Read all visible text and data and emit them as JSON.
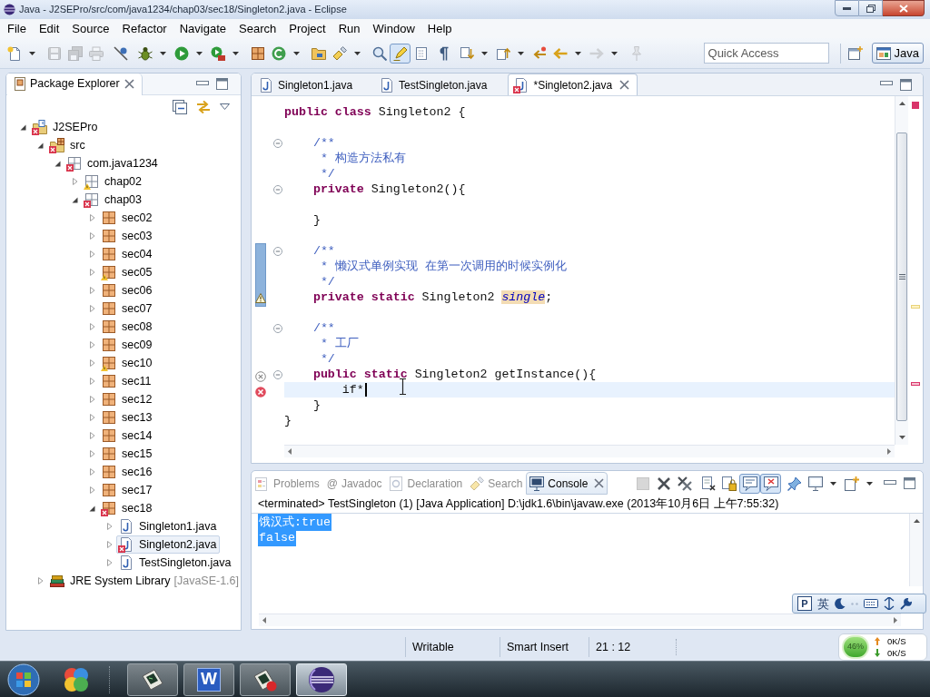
{
  "window": {
    "title": "Java - J2SEPro/src/com/java1234/chap03/sec18/Singleton2.java - Eclipse"
  },
  "menu": [
    "File",
    "Edit",
    "Source",
    "Refactor",
    "Navigate",
    "Search",
    "Project",
    "Run",
    "Window",
    "Help"
  ],
  "toolbar": {
    "groups": [
      {
        "buttons": [
          {
            "kind": "new",
            "menu": true,
            "pressed": false,
            "disabled": false
          }
        ]
      },
      {
        "buttons": [
          {
            "kind": "save",
            "menu": false,
            "pressed": false,
            "disabled": true
          },
          {
            "kind": "save-all",
            "menu": false,
            "pressed": false,
            "disabled": true
          },
          {
            "kind": "print",
            "menu": false,
            "pressed": false,
            "disabled": true
          }
        ]
      },
      {
        "buttons": [
          {
            "kind": "skip-breakpoints",
            "menu": false,
            "pressed": false,
            "disabled": false
          }
        ]
      },
      {
        "buttons": [
          {
            "kind": "debug",
            "menu": true,
            "pressed": false,
            "disabled": false
          },
          {
            "kind": "run",
            "menu": true,
            "pressed": false,
            "disabled": false
          },
          {
            "kind": "external-tools",
            "menu": true,
            "pressed": false,
            "disabled": false
          }
        ]
      },
      {
        "buttons": [
          {
            "kind": "new-package",
            "menu": false,
            "pressed": false,
            "disabled": false
          },
          {
            "kind": "new-class",
            "menu": true,
            "pressed": false,
            "disabled": false
          }
        ]
      },
      {
        "buttons": [
          {
            "kind": "open-type",
            "menu": false,
            "pressed": false,
            "disabled": false
          },
          {
            "kind": "search",
            "menu": true,
            "pressed": false,
            "disabled": false
          }
        ]
      },
      {
        "buttons": [
          {
            "kind": "open-task",
            "menu": false,
            "pressed": false,
            "disabled": false
          },
          {
            "kind": "mark-occurrences",
            "menu": false,
            "pressed": true,
            "disabled": false
          },
          {
            "kind": "block-selection",
            "menu": false,
            "pressed": false,
            "disabled": false
          },
          {
            "kind": "whitespace",
            "menu": false,
            "pressed": false,
            "disabled": false
          }
        ]
      },
      {
        "buttons": [
          {
            "kind": "next-annotation",
            "menu": true,
            "pressed": false,
            "disabled": false
          },
          {
            "kind": "prev-annotation",
            "menu": true,
            "pressed": false,
            "disabled": false
          },
          {
            "kind": "last-edit",
            "menu": false,
            "pressed": false,
            "disabled": false
          },
          {
            "kind": "back",
            "menu": true,
            "pressed": false,
            "disabled": false
          },
          {
            "kind": "forward",
            "menu": true,
            "pressed": false,
            "disabled": true
          }
        ]
      },
      {
        "buttons": [
          {
            "kind": "pin",
            "menu": false,
            "pressed": false,
            "disabled": true
          }
        ]
      }
    ],
    "quick_access": {
      "placeholder": "Quick Access"
    },
    "perspectives": [
      {
        "label": "Java",
        "selected": true
      }
    ]
  },
  "package_explorer": {
    "title": "Package Explorer",
    "tree": [
      {
        "label": "J2SEPro",
        "kind": "project",
        "error": true,
        "warning": false,
        "expanded": true,
        "selected": false,
        "children": [
          {
            "label": "src",
            "kind": "source-folder",
            "error": true,
            "warning": false,
            "expanded": true,
            "selected": false,
            "children": [
              {
                "label": "com.java1234",
                "kind": "empty-package",
                "error": true,
                "warning": false,
                "expanded": true,
                "selected": false,
                "children": [
                  {
                    "label": "chap02",
                    "kind": "empty-package",
                    "error": false,
                    "warning": true,
                    "expanded": false,
                    "selected": false
                  },
                  {
                    "label": "chap03",
                    "kind": "empty-package",
                    "error": true,
                    "warning": false,
                    "expanded": true,
                    "selected": false,
                    "children": [
                      {
                        "label": "sec02",
                        "kind": "package",
                        "error": false,
                        "warning": false,
                        "expanded": false,
                        "selected": false
                      },
                      {
                        "label": "sec03",
                        "kind": "package",
                        "error": false,
                        "warning": false,
                        "expanded": false,
                        "selected": false
                      },
                      {
                        "label": "sec04",
                        "kind": "package",
                        "error": false,
                        "warning": false,
                        "expanded": false,
                        "selected": false
                      },
                      {
                        "label": "sec05",
                        "kind": "package",
                        "error": false,
                        "warning": true,
                        "expanded": false,
                        "selected": false
                      },
                      {
                        "label": "sec06",
                        "kind": "package",
                        "error": false,
                        "warning": false,
                        "expanded": false,
                        "selected": false
                      },
                      {
                        "label": "sec07",
                        "kind": "package",
                        "error": false,
                        "warning": false,
                        "expanded": false,
                        "selected": false
                      },
                      {
                        "label": "sec08",
                        "kind": "package",
                        "error": false,
                        "warning": false,
                        "expanded": false,
                        "selected": false
                      },
                      {
                        "label": "sec09",
                        "kind": "package",
                        "error": false,
                        "warning": false,
                        "expanded": false,
                        "selected": false
                      },
                      {
                        "label": "sec10",
                        "kind": "package",
                        "error": false,
                        "warning": true,
                        "expanded": false,
                        "selected": false
                      },
                      {
                        "label": "sec11",
                        "kind": "package",
                        "error": false,
                        "warning": false,
                        "expanded": false,
                        "selected": false
                      },
                      {
                        "label": "sec12",
                        "kind": "package",
                        "error": false,
                        "warning": false,
                        "expanded": false,
                        "selected": false
                      },
                      {
                        "label": "sec13",
                        "kind": "package",
                        "error": false,
                        "warning": false,
                        "expanded": false,
                        "selected": false
                      },
                      {
                        "label": "sec14",
                        "kind": "package",
                        "error": false,
                        "warning": false,
                        "expanded": false,
                        "selected": false
                      },
                      {
                        "label": "sec15",
                        "kind": "package",
                        "error": false,
                        "warning": false,
                        "expanded": false,
                        "selected": false
                      },
                      {
                        "label": "sec16",
                        "kind": "package",
                        "error": false,
                        "warning": false,
                        "expanded": false,
                        "selected": false
                      },
                      {
                        "label": "sec17",
                        "kind": "package",
                        "error": false,
                        "warning": false,
                        "expanded": false,
                        "selected": false
                      },
                      {
                        "label": "sec18",
                        "kind": "package",
                        "error": true,
                        "warning": false,
                        "expanded": true,
                        "selected": false,
                        "children": [
                          {
                            "label": "Singleton1.java",
                            "kind": "java-file",
                            "error": false,
                            "warning": false,
                            "expanded": false,
                            "selected": false
                          },
                          {
                            "label": "Singleton2.java",
                            "kind": "java-file",
                            "error": true,
                            "warning": false,
                            "expanded": false,
                            "selected": true
                          },
                          {
                            "label": "TestSingleton.java",
                            "kind": "java-file",
                            "error": false,
                            "warning": false,
                            "expanded": false,
                            "selected": false
                          }
                        ]
                      }
                    ]
                  }
                ]
              }
            ]
          },
          {
            "label": "JRE System Library",
            "decoration": "[JavaSE-1.6]",
            "kind": "library",
            "error": false,
            "warning": false,
            "expanded": false,
            "selected": false
          }
        ]
      }
    ]
  },
  "editor": {
    "tabs": [
      {
        "label": "Singleton1.java",
        "error": false,
        "selected": false
      },
      {
        "label": "TestSingleton.java",
        "error": false,
        "selected": false
      },
      {
        "label": "*Singleton2.java",
        "error": true,
        "selected": true
      }
    ],
    "lines": [
      {
        "tokens": [
          {
            "kind": "keyword",
            "text": "public "
          },
          {
            "kind": "keyword",
            "text": "class "
          },
          {
            "kind": "text",
            "text": "Singleton2 {"
          }
        ],
        "fold": false,
        "changed": false,
        "current": false,
        "warning": false,
        "error": false,
        "stale_error": false
      },
      {
        "fold": false,
        "changed": false,
        "current": false,
        "warning": false,
        "error": false,
        "stale_error": false
      },
      {
        "tokens": [
          {
            "kind": "comment",
            "text": "    /**"
          }
        ],
        "fold": true,
        "changed": false,
        "current": false,
        "warning": false,
        "error": false,
        "stale_error": false
      },
      {
        "tokens": [
          {
            "kind": "comment",
            "text": "     * 构造方法私有"
          }
        ],
        "fold": false,
        "changed": false,
        "current": false,
        "warning": false,
        "error": false,
        "stale_error": false
      },
      {
        "tokens": [
          {
            "kind": "comment",
            "text": "     */"
          }
        ],
        "fold": false,
        "changed": false,
        "current": false,
        "warning": false,
        "error": false,
        "stale_error": false
      },
      {
        "tokens": [
          {
            "kind": "keyword",
            "text": "    private "
          },
          {
            "kind": "text",
            "text": "Singleton2(){"
          }
        ],
        "fold": true,
        "changed": false,
        "current": false,
        "warning": false,
        "error": false,
        "stale_error": false
      },
      {
        "fold": false,
        "changed": false,
        "current": false,
        "warning": false,
        "error": false,
        "stale_error": false
      },
      {
        "tokens": [
          {
            "kind": "text",
            "text": "    }"
          }
        ],
        "fold": false,
        "changed": false,
        "current": false,
        "warning": false,
        "error": false,
        "stale_error": false
      },
      {
        "fold": false,
        "changed": false,
        "current": false,
        "warning": false,
        "error": false,
        "stale_error": false
      },
      {
        "tokens": [
          {
            "kind": "comment",
            "text": "    /**"
          }
        ],
        "fold": true,
        "changed": true,
        "current": false,
        "warning": false,
        "error": false,
        "stale_error": false
      },
      {
        "tokens": [
          {
            "kind": "comment",
            "text": "     * 懒汉式单例实现 在第一次调用的时候实例化"
          }
        ],
        "fold": false,
        "changed": true,
        "current": false,
        "warning": false,
        "error": false,
        "stale_error": false
      },
      {
        "tokens": [
          {
            "kind": "comment",
            "text": "     */"
          }
        ],
        "fold": false,
        "changed": true,
        "current": false,
        "warning": false,
        "error": false,
        "stale_error": false
      },
      {
        "tokens": [
          {
            "kind": "keyword",
            "text": "    private "
          },
          {
            "kind": "keyword",
            "text": "static "
          },
          {
            "kind": "text",
            "text": "Singleton2 "
          },
          {
            "kind": "field",
            "text": "single"
          },
          {
            "kind": "text",
            "text": ";"
          }
        ],
        "fold": false,
        "changed": true,
        "current": false,
        "warning": true,
        "error": false,
        "stale_error": false
      },
      {
        "fold": false,
        "changed": false,
        "current": false,
        "warning": false,
        "error": false,
        "stale_error": false
      },
      {
        "tokens": [
          {
            "kind": "comment",
            "text": "    /**"
          }
        ],
        "fold": true,
        "changed": false,
        "current": false,
        "warning": false,
        "error": false,
        "stale_error": false
      },
      {
        "tokens": [
          {
            "kind": "comment",
            "text": "     * 工厂"
          }
        ],
        "fold": false,
        "changed": false,
        "current": false,
        "warning": false,
        "error": false,
        "stale_error": false
      },
      {
        "tokens": [
          {
            "kind": "comment",
            "text": "     */"
          }
        ],
        "fold": false,
        "changed": false,
        "current": false,
        "warning": false,
        "error": false,
        "stale_error": false
      },
      {
        "tokens": [
          {
            "kind": "keyword",
            "text": "    public "
          },
          {
            "kind": "keyword",
            "text": "static "
          },
          {
            "kind": "text",
            "text": "Singleton2 getInstance(){"
          }
        ],
        "fold": true,
        "changed": false,
        "current": false,
        "warning": false,
        "error": false,
        "stale_error": true
      },
      {
        "tokens": [
          {
            "kind": "text",
            "text": "        if*"
          }
        ],
        "fold": false,
        "changed": false,
        "current": true,
        "warning": false,
        "error": true,
        "stale_error": false
      },
      {
        "tokens": [
          {
            "kind": "text",
            "text": "    }"
          }
        ],
        "fold": false,
        "changed": false,
        "current": false,
        "warning": false,
        "error": false,
        "stale_error": false
      },
      {
        "tokens": [
          {
            "kind": "text",
            "text": "}"
          }
        ],
        "fold": false,
        "changed": false,
        "current": false,
        "warning": false,
        "error": false,
        "stale_error": false
      }
    ]
  },
  "console_view": {
    "tabs": [
      {
        "label": "Problems",
        "kind": "problems",
        "selected": false
      },
      {
        "label": "Javadoc",
        "kind": "javadoc",
        "glyph": "@",
        "selected": false
      },
      {
        "label": "Declaration",
        "kind": "declaration",
        "selected": false
      },
      {
        "label": "Search",
        "kind": "search",
        "selected": false
      },
      {
        "label": "Console",
        "kind": "console",
        "selected": true
      }
    ],
    "toolbar": [
      {
        "buttons": [
          {
            "kind": "terminate",
            "menu": false,
            "pressed": false,
            "disabled": true
          },
          {
            "kind": "remove-launch",
            "menu": false,
            "pressed": false,
            "disabled": false
          },
          {
            "kind": "remove-all",
            "menu": false,
            "pressed": false,
            "disabled": false
          }
        ]
      },
      {
        "buttons": [
          {
            "kind": "clear-console",
            "menu": false,
            "pressed": false,
            "disabled": false
          },
          {
            "kind": "scroll-lock",
            "menu": false,
            "pressed": false,
            "disabled": false
          },
          {
            "kind": "show-on-output",
            "menu": false,
            "pressed": true,
            "disabled": false
          },
          {
            "kind": "show-on-error",
            "menu": false,
            "pressed": true,
            "disabled": false
          }
        ]
      },
      {
        "buttons": [
          {
            "kind": "pin-console",
            "menu": false,
            "pressed": false,
            "disabled": false
          },
          {
            "kind": "display-console",
            "menu": true,
            "pressed": false,
            "disabled": false
          },
          {
            "kind": "open-console",
            "menu": true,
            "pressed": false,
            "disabled": false
          }
        ]
      }
    ],
    "header": "<terminated> TestSingleton (1) [Java Application] D:\\jdk1.6\\bin\\javaw.exe (2013年10月6日 上午7:55:32)",
    "output": [
      {
        "text": "饿汉式:true",
        "selected": true
      },
      {
        "text": "false",
        "selected": true
      }
    ]
  },
  "ime_bar": {
    "logo": "P",
    "mode": "英"
  },
  "status_bar": {
    "fields": [
      "Writable",
      "Smart Insert",
      "21 : 12"
    ]
  },
  "network_meter": {
    "usage": "46%",
    "upload": "0K/S",
    "download": "0K/S"
  },
  "taskbar": {
    "buttons": [
      {
        "kind": "palette",
        "selected": false
      },
      {
        "kind": "terminal",
        "selected": false
      },
      {
        "kind": "writer",
        "glyph": "W",
        "selected": false
      },
      {
        "kind": "recorder",
        "selected": false
      },
      {
        "kind": "eclipse",
        "selected": true
      }
    ]
  }
}
